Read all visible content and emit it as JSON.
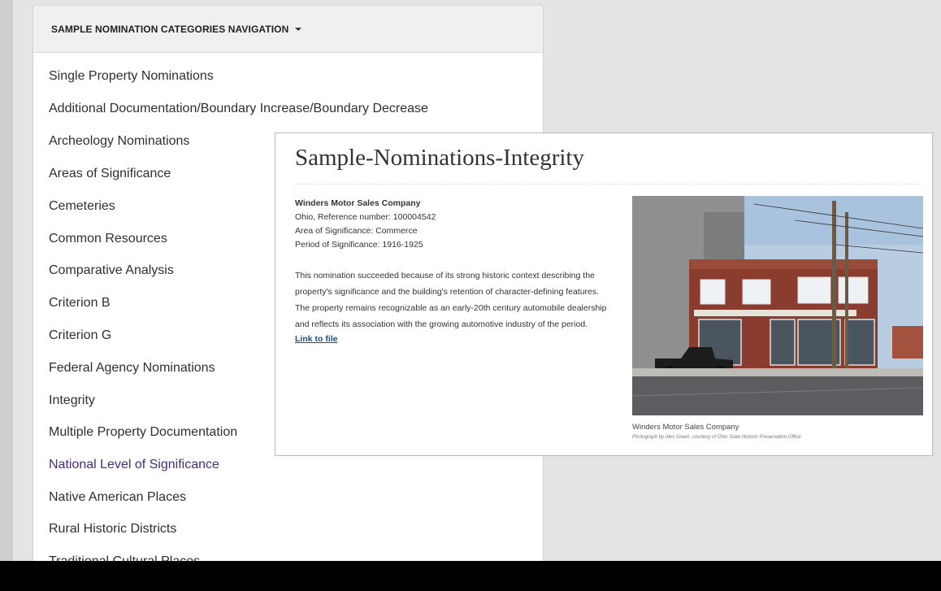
{
  "nav": {
    "header_label": "SAMPLE NOMINATION CATEGORIES NAVIGATION",
    "items": [
      {
        "label": "Single Property Nominations"
      },
      {
        "label": "Additional Documentation/Boundary Increase/Boundary Decrease"
      },
      {
        "label": "Archeology Nominations"
      },
      {
        "label": "Areas of Significance"
      },
      {
        "label": "Cemeteries"
      },
      {
        "label": "Common Resources"
      },
      {
        "label": "Comparative Analysis"
      },
      {
        "label": "Criterion B"
      },
      {
        "label": "Criterion G"
      },
      {
        "label": "Federal Agency Nominations"
      },
      {
        "label": "Integrity"
      },
      {
        "label": "Multiple Property Documentation"
      },
      {
        "label": "National Level of Significance"
      },
      {
        "label": "Native American Places"
      },
      {
        "label": "Rural Historic Districts"
      },
      {
        "label": "Traditional Cultural Places"
      }
    ]
  },
  "card": {
    "title": "Sample-Nominations-Integrity",
    "property_name": "Winders Motor Sales Company",
    "reference": "Ohio, Reference number: 100004542",
    "area": "Area of Significance: Commerce",
    "period": "Period of Significance: 1916-1925",
    "description": "This nomination succeeded because of its strong historic context describing the property's significance and the building's retention of character-defining features. The property remains recognizable as an early-20th century automobile dealership and reflects its association with the growing automotive industry of the period.",
    "link_label": "Link to file",
    "photo_caption": "Winders Motor Sales Company",
    "photo_credit": "Photograph by Alex Green, courtesy of Ohio State Historic Preservation Office"
  },
  "colors": {
    "visited_link": "#4a2b7a",
    "link": "#1a4f8b",
    "backdrop": "#e4e4e4"
  }
}
